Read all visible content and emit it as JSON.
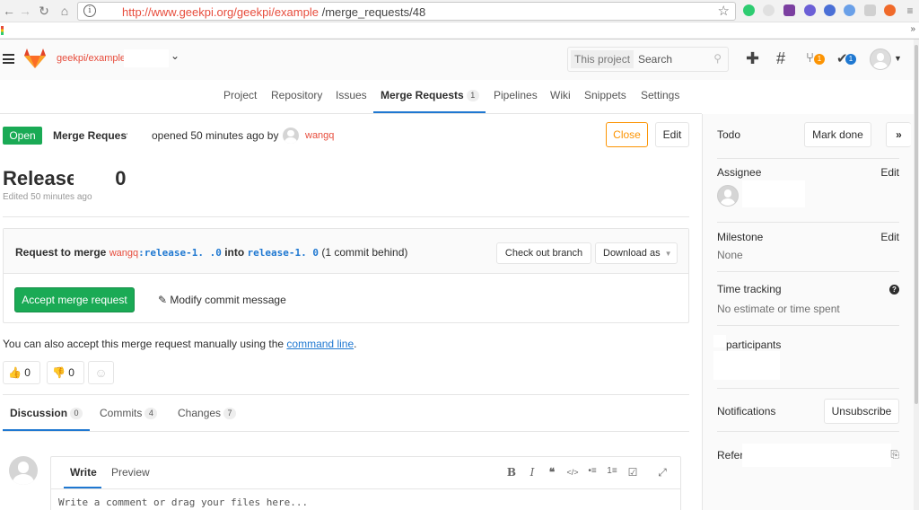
{
  "browser": {
    "url_host": "http://www.geekpi.org/geekpi/example",
    "url_path": " /merge_requests/48",
    "back_icon": "back-arrow-icon",
    "forward_icon": "forward-arrow-icon"
  },
  "header": {
    "project_name": "geekpi/example",
    "search_scope": "This project",
    "search_placeholder": "Search",
    "mr_badge": "1",
    "todo_badge": "1"
  },
  "subnav": {
    "items": [
      "Project",
      "Repository",
      "Issues",
      "Merge Requests",
      "Pipelines",
      "Wiki",
      "Snippets",
      "Settings"
    ],
    "mr_count": "1",
    "active": "Merge Requests"
  },
  "mr": {
    "status": "Open",
    "label": "Merge Request",
    "opened_text": "opened 50 minutes ago by",
    "author": "wangq",
    "close_label": "Close",
    "edit_label": "Edit",
    "title_start": "Release",
    "title_end": "0",
    "edited": "Edited 50 minutes ago"
  },
  "merge": {
    "request_to_merge": "Request to merge",
    "source_user": "wangq",
    "source_branch": ":release-1.  .0",
    "into": "into",
    "target_branch": "release-1.  0",
    "behind": "(1 commit behind)",
    "checkout_label": "Check out branch",
    "download_label": "Download as",
    "accept_label": "Accept merge request",
    "modify_label": "Modify commit message"
  },
  "manual": {
    "prefix": "You can also accept this merge request manually using the ",
    "link": "command line",
    "suffix": "."
  },
  "emoji": {
    "thumbsup_count": "0",
    "thumbsdown_count": "0"
  },
  "tabs": [
    {
      "label": "Discussion",
      "count": "0"
    },
    {
      "label": "Commits",
      "count": "4"
    },
    {
      "label": "Changes",
      "count": "7"
    }
  ],
  "comment": {
    "write_label": "Write",
    "preview_label": "Preview",
    "placeholder": "Write a comment or drag your files here...",
    "tools": [
      "B",
      "I",
      "❝",
      "</>",
      "•≡",
      "1≡",
      "☑",
      "⤢"
    ]
  },
  "sidebar": {
    "todo_label": "Todo",
    "mark_done": "Mark done",
    "collapse": "»",
    "assignee_label": "Assignee",
    "assignee_edit": "Edit",
    "milestone_label": "Milestone",
    "milestone_edit": "Edit",
    "milestone_value": "None",
    "time_label": "Time tracking",
    "time_value": "No estimate or time spent",
    "participants_label": "participants",
    "notifications_label": "Notifications",
    "unsubscribe": "Unsubscribe",
    "reference_label": "Refer"
  },
  "colors": {
    "green": "#1aaa55",
    "orange": "#fc9403",
    "blue": "#1f78d1",
    "red": "#e74c3c"
  }
}
